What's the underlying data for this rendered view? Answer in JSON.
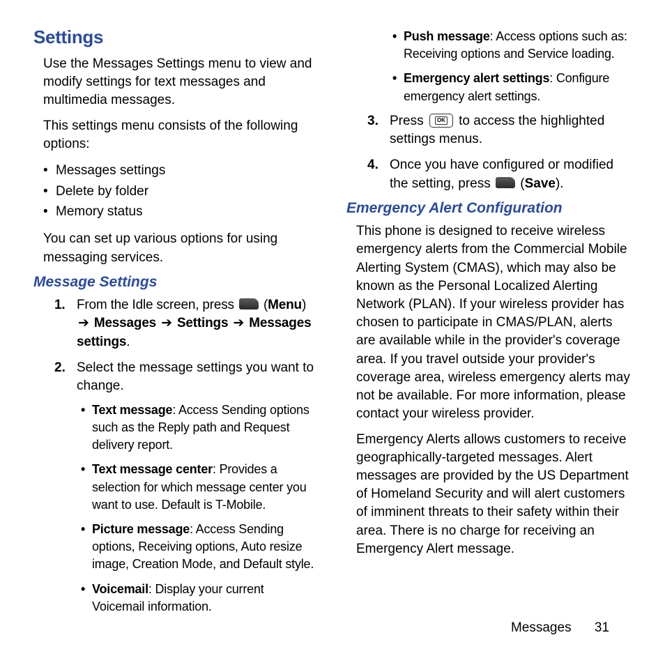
{
  "title": "Settings",
  "intro1": "Use the Messages Settings menu to view and modify settings for text messages and multimedia messages.",
  "intro2": "This settings menu consists of the following options:",
  "topBullets": [
    "Messages settings",
    "Delete by folder",
    "Memory status"
  ],
  "intro3": "You can set up various options for using messaging services.",
  "msgSettingsHead": "Message Settings",
  "step1_a": "From the Idle screen, press ",
  "step1_b": " (",
  "step1_menuLabel": "Menu",
  "step1_c": ") ",
  "step1_d": " Messages ",
  "step1_e": " Settings ",
  "step1_f": " Messages settings",
  "step1_g": ".",
  "arrow": "➔",
  "step2": "Select the message settings you want to change.",
  "subs": [
    {
      "label": "Text message",
      "desc": ": Access Sending options such as the Reply path and Request delivery report."
    },
    {
      "label": "Text message center",
      "desc": ": Provides a selection for which message center you want to use. Default is T-Mobile."
    },
    {
      "label": "Picture message",
      "desc": ": Access Sending options, Receiving options, Auto resize image, Creation Mode, and Default style."
    },
    {
      "label": "Voicemail",
      "desc": ": Display your current Voicemail information."
    },
    {
      "label": "Push message",
      "desc": ": Access options such as: Receiving options and Service loading."
    },
    {
      "label": "Emergency alert settings",
      "desc": ": Configure emergency alert settings."
    }
  ],
  "step3_a": "Press ",
  "step3_b": " to access the highlighted settings menus.",
  "step4_a": "Once you have configured or modified the setting, press ",
  "step4_b": " (",
  "step4_saveLabel": "Save",
  "step4_c": ").",
  "emergencyHead": "Emergency Alert Configuration",
  "emergencyP1": "This phone is designed to receive wireless emergency alerts from the Commercial Mobile Alerting System (CMAS), which may also be known as the Personal Localized Alerting Network (PLAN). If your wireless provider has chosen to participate in CMAS/PLAN, alerts are available while in the provider's coverage area. If you travel outside your provider's coverage area, wireless emergency alerts may not be available. For more information, please contact your wireless provider.",
  "emergencyP2": "Emergency Alerts allows customers to receive geographically-targeted messages. Alert messages are provided by the US Department of Homeland Security and will alert customers of imminent threats to their safety within their area. There is no charge for receiving an Emergency Alert message.",
  "footerSection": "Messages",
  "footerPage": "31"
}
